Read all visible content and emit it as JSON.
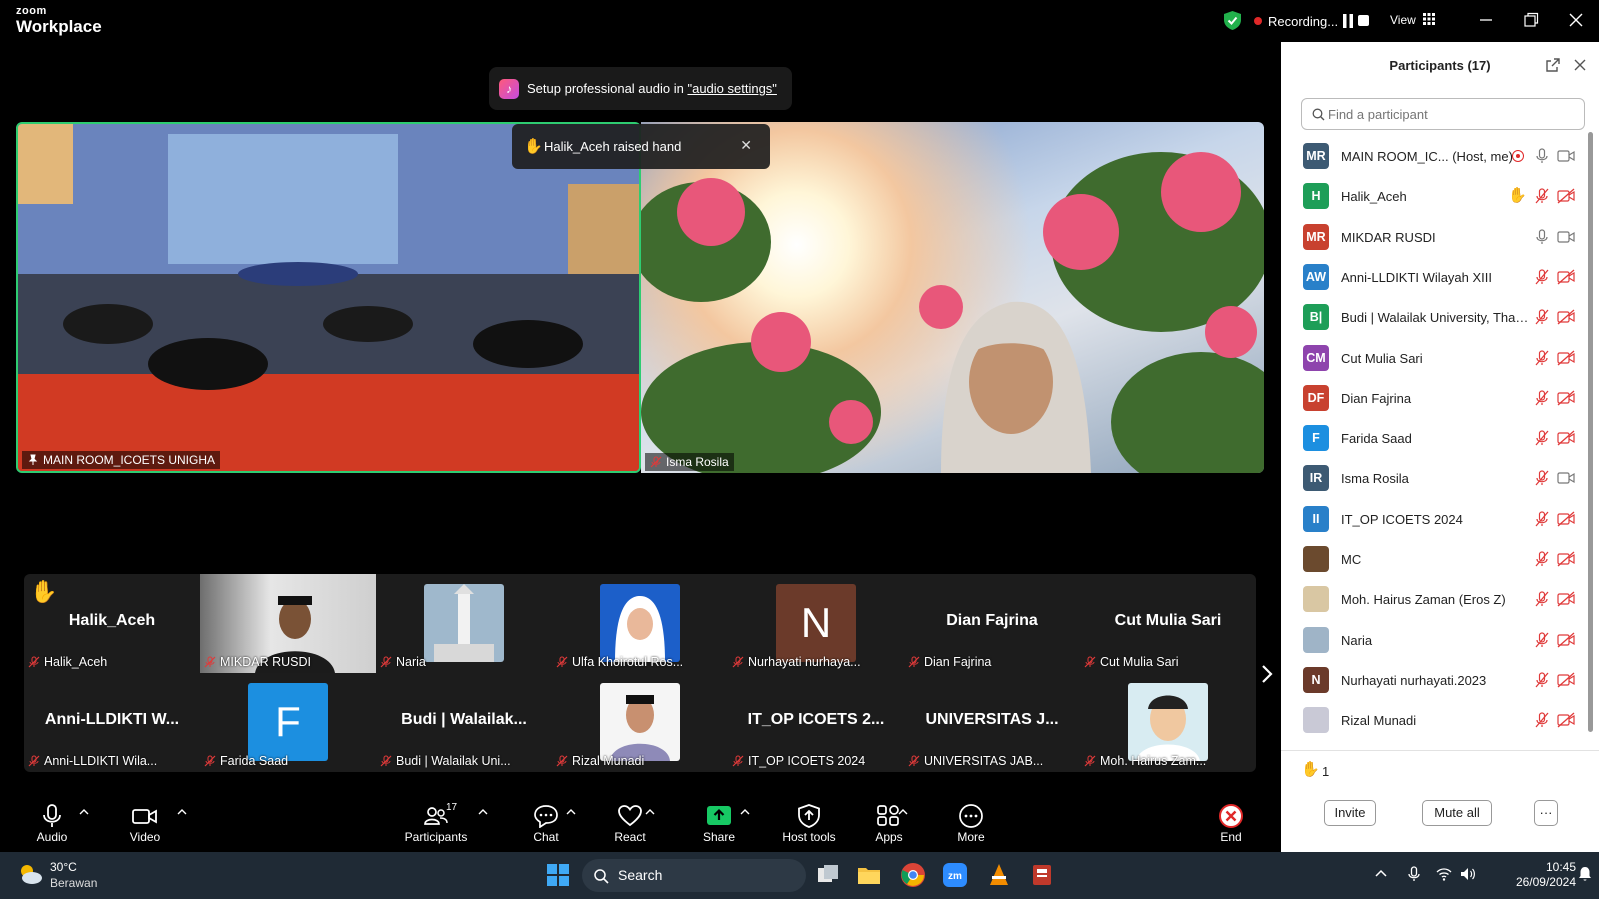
{
  "app": {
    "brand_small": "zoom",
    "brand_large": "Workplace"
  },
  "topbar": {
    "recording_label": "Recording...",
    "view_label": "View"
  },
  "notice": {
    "text_prefix": "Setup professional audio in ",
    "link_text": "\"audio settings\""
  },
  "stage": {
    "left_tile_label": "MAIN ROOM_ICOETS UNIGHA",
    "right_tile_label": "Isma Rosila",
    "raised_hand_text": "Halik_Aceh raised hand"
  },
  "gallery": {
    "row1": [
      {
        "display": "Halik_Aceh",
        "label": "Halik_Aceh",
        "kind": "name",
        "hand": true
      },
      {
        "display": "",
        "label": "MIKDAR RUSDI",
        "kind": "video"
      },
      {
        "display": "",
        "label": "Naria",
        "kind": "pic-tower"
      },
      {
        "display": "",
        "label": "Ulfa Khoirotul Ros...",
        "kind": "pic-woman"
      },
      {
        "display": "N",
        "label": "Nurhayati nurhaya...",
        "kind": "letter"
      },
      {
        "display": "Dian Fajrina",
        "label": "Dian Fajrina",
        "kind": "name"
      },
      {
        "display": "Cut Mulia Sari",
        "label": "Cut Mulia Sari",
        "kind": "name"
      }
    ],
    "row2": [
      {
        "display": "Anni-LLDIKTI W...",
        "label": "Anni-LLDIKTI Wila...",
        "kind": "name"
      },
      {
        "display": "F",
        "label": "Farida Saad",
        "kind": "letter-blue"
      },
      {
        "display": "Budi | Walailak...",
        "label": "Budi | Walailak Uni...",
        "kind": "name"
      },
      {
        "display": "",
        "label": "Rizal Munadi",
        "kind": "pic-man"
      },
      {
        "display": "IT_OP ICOETS 2...",
        "label": "IT_OP ICOETS 2024",
        "kind": "name"
      },
      {
        "display": "UNIVERSITAS J...",
        "label": "UNIVERSITAS JAB...",
        "kind": "name"
      },
      {
        "display": "",
        "label": "Moh. Hairus Zam...",
        "kind": "pic-cartoon"
      }
    ]
  },
  "toolbar": {
    "audio": "Audio",
    "video": "Video",
    "participants": "Participants",
    "participants_count": "17",
    "chat": "Chat",
    "react": "React",
    "share": "Share",
    "host_tools": "Host tools",
    "apps": "Apps",
    "more": "More",
    "end": "End"
  },
  "panel": {
    "title": "Participants (17)",
    "search_placeholder": "Find a participant",
    "participants": [
      {
        "initials": "MR",
        "name": "MAIN ROOM_IC... (Host, me)",
        "color": "#3d5a73",
        "mic": "on",
        "cam": "on",
        "rec": true
      },
      {
        "initials": "H",
        "name": "Halik_Aceh",
        "color": "#1e9e58",
        "mic": "off",
        "cam": "off",
        "hand": true
      },
      {
        "initials": "MR",
        "name": "MIKDAR RUSDI",
        "color": "#c8412f",
        "mic": "on",
        "cam": "on"
      },
      {
        "initials": "AW",
        "name": "Anni-LLDIKTI Wilayah XIII",
        "color": "#2980c9",
        "mic": "off",
        "cam": "off"
      },
      {
        "initials": "B|",
        "name": "Budi | Walailak University, Thail...",
        "color": "#1e9e58",
        "mic": "off",
        "cam": "off"
      },
      {
        "initials": "CM",
        "name": "Cut Mulia Sari",
        "color": "#8e44ad",
        "mic": "off",
        "cam": "off"
      },
      {
        "initials": "DF",
        "name": "Dian Fajrina",
        "color": "#c8412f",
        "mic": "off",
        "cam": "off"
      },
      {
        "initials": "F",
        "name": "Farida Saad",
        "color": "#1c8fe0",
        "mic": "off",
        "cam": "off"
      },
      {
        "initials": "IR",
        "name": "Isma Rosila",
        "color": "#3d5a73",
        "mic": "off",
        "cam": "on"
      },
      {
        "initials": "II",
        "name": "IT_OP ICOETS 2024",
        "color": "#2980c9",
        "mic": "off",
        "cam": "off"
      },
      {
        "initials": "",
        "name": "MC",
        "color": "#6b4a2e",
        "mic": "off",
        "cam": "off",
        "photo": true
      },
      {
        "initials": "",
        "name": "Moh. Hairus Zaman (Eros Z)",
        "color": "#d9c7a3",
        "mic": "off",
        "cam": "off",
        "photo": true
      },
      {
        "initials": "",
        "name": "Naria",
        "color": "#9fb4c7",
        "mic": "off",
        "cam": "off",
        "photo": true
      },
      {
        "initials": "N",
        "name": "Nurhayati nurhayati.2023",
        "color": "#6b3a2a",
        "mic": "off",
        "cam": "off"
      },
      {
        "initials": "",
        "name": "Rizal Munadi",
        "color": "#c9c9d6",
        "mic": "off",
        "cam": "off",
        "photo": true
      }
    ],
    "raised_hands_count": "1",
    "invite": "Invite",
    "mute_all": "Mute all",
    "more": "···"
  },
  "taskbar": {
    "temperature": "30°C",
    "condition": "Berawan",
    "search": "Search",
    "time": "10:45",
    "date": "26/09/2024"
  },
  "colors": {
    "accent_green": "#2ecc71",
    "end_red": "#e02828",
    "panel_bg": "#ffffff"
  }
}
